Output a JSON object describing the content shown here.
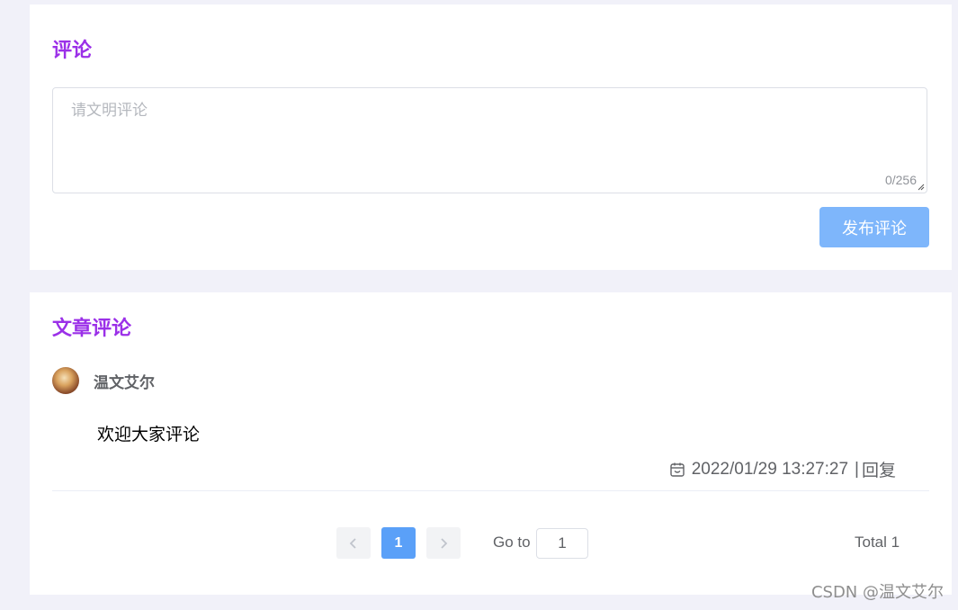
{
  "comment_form": {
    "title": "评论",
    "placeholder": "请文明评论",
    "char_count": "0/256",
    "submit_label": "发布评论"
  },
  "comment_list": {
    "title": "文章评论",
    "comments": [
      {
        "author": "温文艾尔",
        "content": "欢迎大家评论",
        "time": "2022/01/29 13:27:27",
        "separator": "|",
        "reply_label": "回复"
      }
    ]
  },
  "pagination": {
    "current_page": "1",
    "goto_label": "Go to",
    "goto_value": "1",
    "total_label": "Total 1"
  },
  "watermark": "CSDN @温文艾尔",
  "colors": {
    "page_bg": "#f1f1f9",
    "title_accent": "#9b30e8",
    "primary_button": "#7eb6fb",
    "active_page": "#5aa0f8"
  },
  "icons": {
    "time": "calendar-icon",
    "prev": "chevron-left-icon",
    "next": "chevron-right-icon"
  }
}
